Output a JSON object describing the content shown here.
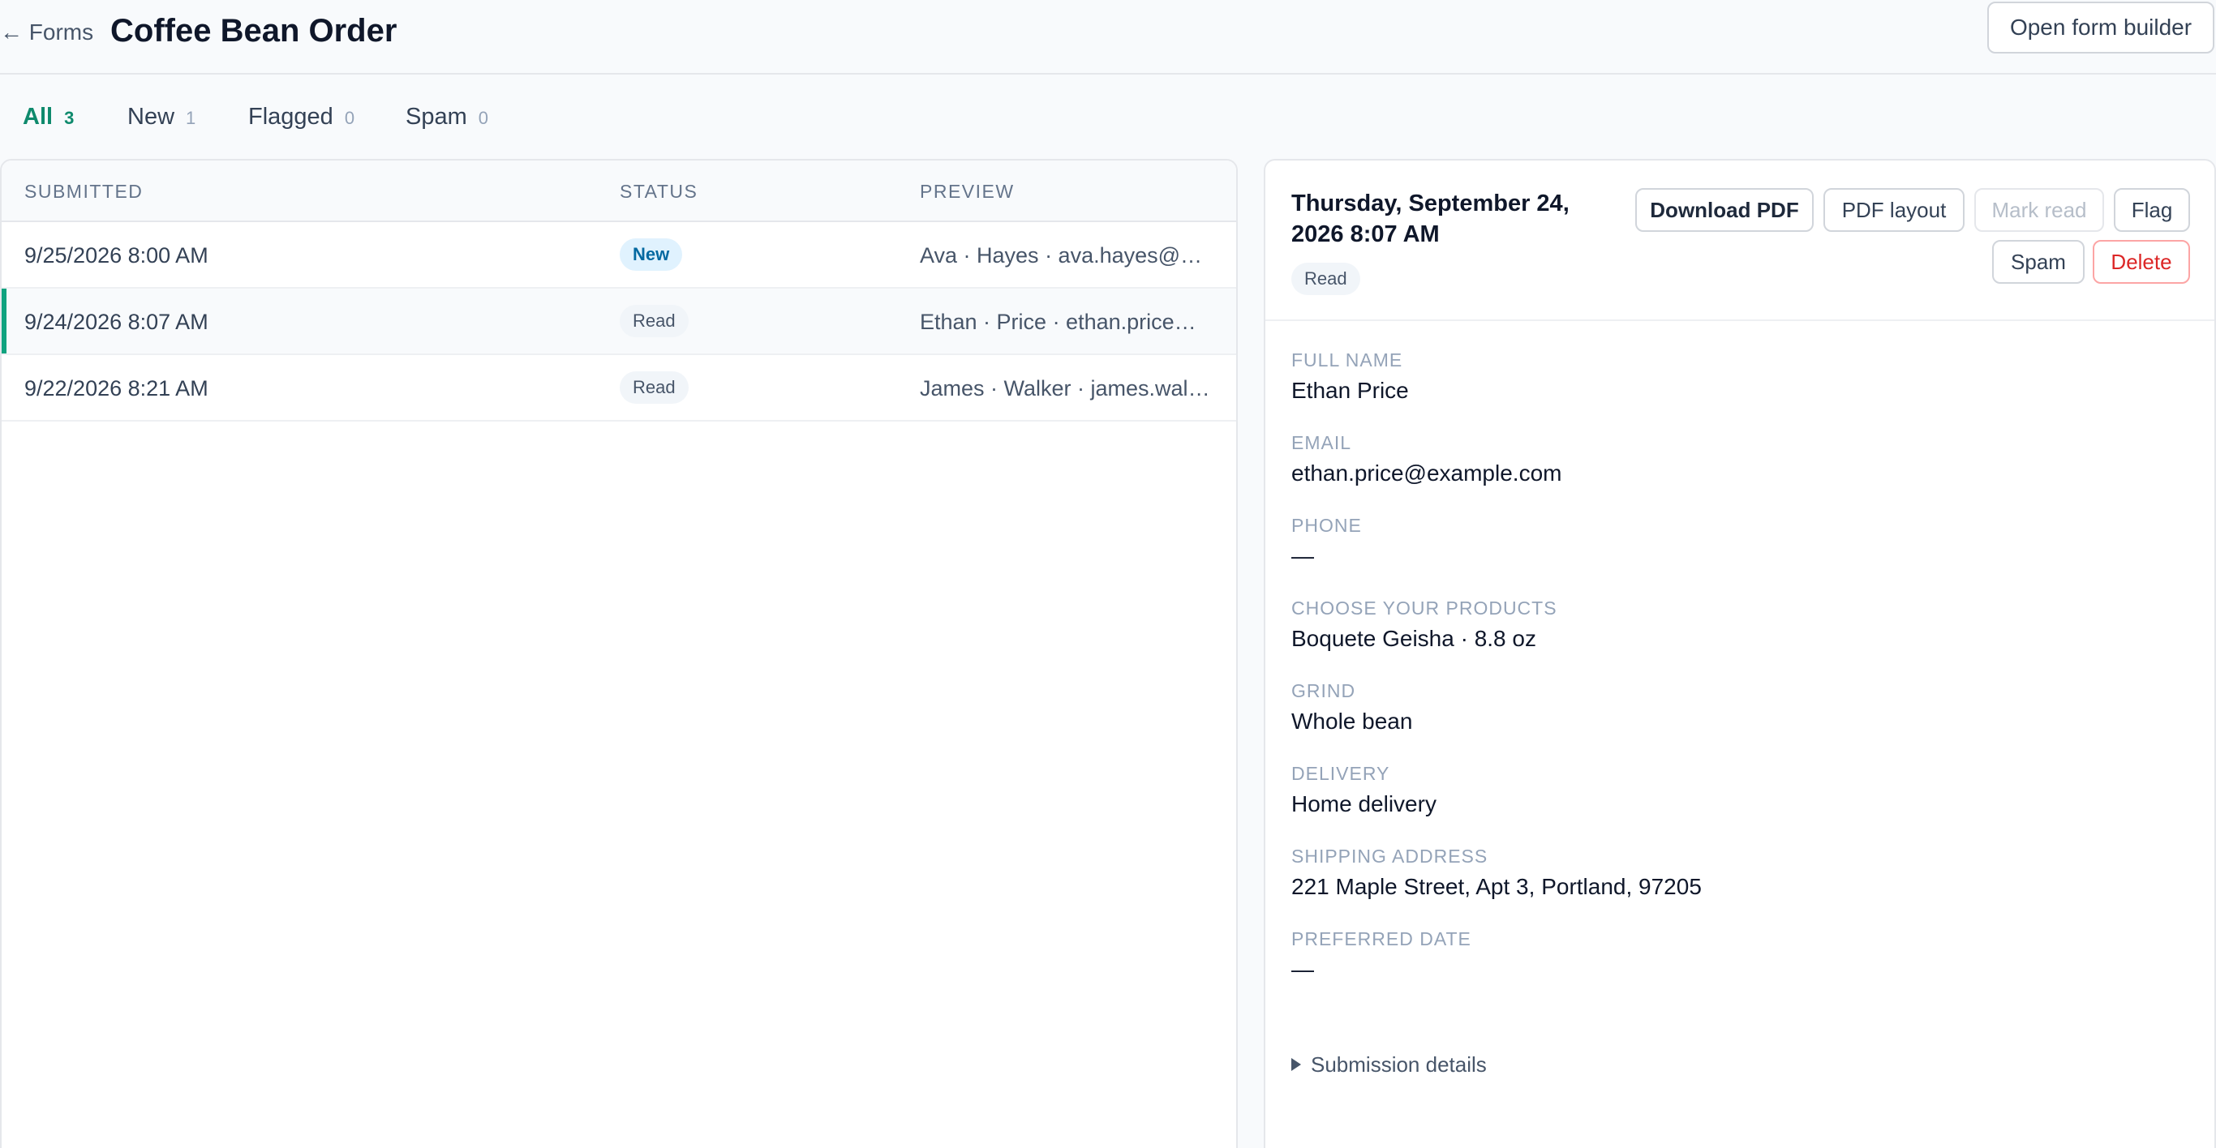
{
  "header": {
    "back_label": "← Forms",
    "title": "Coffee Bean Order",
    "builder_button": "Open form builder"
  },
  "tabs": [
    {
      "label": "All",
      "count": "3",
      "active": true
    },
    {
      "label": "New",
      "count": "1",
      "active": false
    },
    {
      "label": "Flagged",
      "count": "0",
      "active": false
    },
    {
      "label": "Spam",
      "count": "0",
      "active": false
    }
  ],
  "list": {
    "columns": {
      "submitted": "SUBMITTED",
      "status": "STATUS",
      "preview": "PREVIEW"
    },
    "rows": [
      {
        "submitted": "9/25/2026 8:00 AM",
        "status": "New",
        "preview": "Ava · Hayes · ava.hayes@exa..."
      },
      {
        "submitted": "9/24/2026 8:07 AM",
        "status": "Read",
        "preview": "Ethan · Price · ethan.price@e..."
      },
      {
        "submitted": "9/22/2026 8:21 AM",
        "status": "Read",
        "preview": "James · Walker · james.walke..."
      }
    ],
    "selected_index": 1
  },
  "detail": {
    "date": "Thursday, September 24, 2026 8:07 AM",
    "status": "Read",
    "actions": {
      "download_pdf": "Download PDF",
      "pdf_layout": "PDF layout",
      "mark_read": "Mark read",
      "flag": "Flag",
      "spam": "Spam",
      "delete": "Delete"
    },
    "fields": [
      {
        "label": "FULL NAME",
        "value": "Ethan Price"
      },
      {
        "label": "EMAIL",
        "value": "ethan.price@example.com"
      },
      {
        "label": "PHONE",
        "value": "—"
      },
      {
        "label": "CHOOSE YOUR PRODUCTS",
        "value": "Boquete Geisha · 8.8 oz"
      },
      {
        "label": "GRIND",
        "value": "Whole bean"
      },
      {
        "label": "DELIVERY",
        "value": "Home delivery"
      },
      {
        "label": "SHIPPING ADDRESS",
        "value": "221 Maple Street, Apt 3, Portland, 97205"
      },
      {
        "label": "PREFERRED DATE",
        "value": "—"
      }
    ],
    "submission_details": "Submission details"
  },
  "colors": {
    "accent": "#0f8a6d",
    "selected_bar": "#10a37f",
    "new_badge_bg": "#e0f2fe",
    "delete_text": "#dc2626"
  },
  "icons": {
    "back": "arrow-left-icon",
    "submission_toggle": "triangle-right-icon"
  }
}
